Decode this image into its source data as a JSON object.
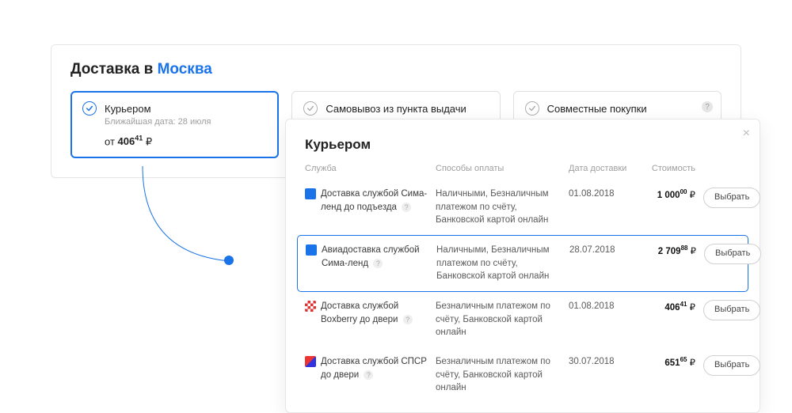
{
  "header": {
    "prefix": "Доставка в ",
    "city": "Москва"
  },
  "options": [
    {
      "title": "Курьером",
      "sub": "Ближайшая дата: 28 июля",
      "price_prefix": "от ",
      "price_int": "406",
      "price_dec": "41",
      "selected": true
    },
    {
      "title": "Самовывоз из пункта выдачи",
      "selected": false
    },
    {
      "title": "Совместные покупки",
      "selected": false
    }
  ],
  "modal": {
    "title": "Курьером",
    "columns": {
      "svc": "Служба",
      "pay": "Способы оплаты",
      "date": "Дата доставки",
      "cost": "Стоимость"
    },
    "select_label": "Выбрать",
    "currency": "₽",
    "rows": [
      {
        "svc": "Доставка службой Сима-ленд до подъезда",
        "icon": "sima",
        "pay": "Наличными, Безналичным платежом по счёту, Банковской картой онлайн",
        "date": "01.08.2018",
        "cost_int": "1 000",
        "cost_dec": "00",
        "selected": false
      },
      {
        "svc": "Авиадоставка службой Сима-ленд",
        "icon": "sima",
        "pay": "Наличными, Безналичным платежом по счёту, Банковской картой онлайн",
        "date": "28.07.2018",
        "cost_int": "2 709",
        "cost_dec": "88",
        "selected": true
      },
      {
        "svc": "Доставка службой Boxberry до двери",
        "icon": "boxb",
        "pay": "Безналичным платежом по счёту, Банковской картой онлайн",
        "date": "01.08.2018",
        "cost_int": "406",
        "cost_dec": "41",
        "selected": false
      },
      {
        "svc": "Доставка службой СПСР до двери",
        "icon": "spsr",
        "pay": "Безналичным платежом по счёту, Банковской картой онлайн",
        "date": "30.07.2018",
        "cost_int": "651",
        "cost_dec": "65",
        "selected": false
      }
    ]
  }
}
